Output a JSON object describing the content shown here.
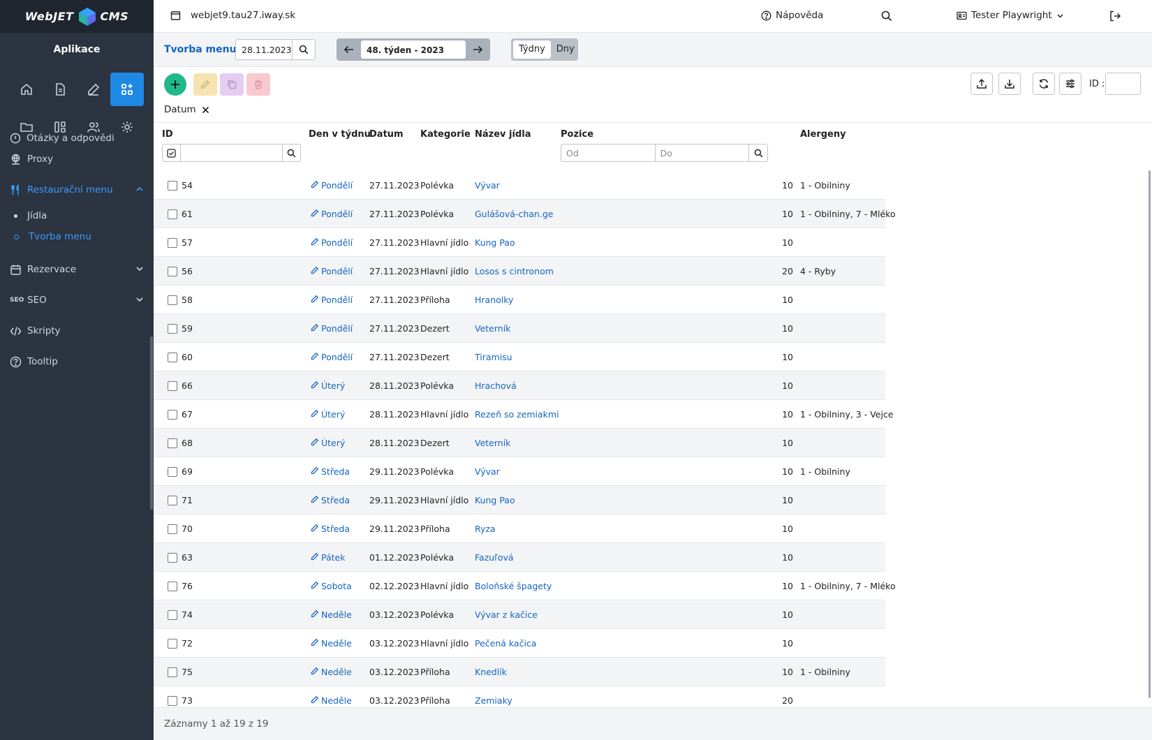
{
  "brand": {
    "left": "WebJET",
    "right": "CMS"
  },
  "sidebar": {
    "title": "Aplikace",
    "cut_item": "Otázky a odpovědi",
    "items": [
      {
        "label": "Proxy"
      },
      {
        "label": "Restaurační menu"
      },
      {
        "label": "Rezervace"
      },
      {
        "label": "SEO"
      },
      {
        "label": "Skripty"
      },
      {
        "label": "Tooltip"
      }
    ],
    "sub_items": [
      {
        "label": "Jídla"
      },
      {
        "label": "Tvorba menu"
      }
    ],
    "seo_badge": "SEO"
  },
  "topbar": {
    "host": "webjet9.tau27.iway.sk",
    "help": "Nápověda",
    "user": "Tester Playwright"
  },
  "filterbar": {
    "title": "Tvorba menu",
    "date": "28.11.2023",
    "week": "48. týden - 2023",
    "toggle_weeks": "Týdny",
    "toggle_days": "Dny"
  },
  "toolbar": {
    "id_label": "ID :",
    "filter_chip": "Datum"
  },
  "columns": {
    "id": "ID",
    "day": "Den v týdnu",
    "date": "Datum",
    "category": "Kategorie",
    "name": "Název jídla",
    "position": "Pozice",
    "allergens": "Alergeny",
    "pos_from": "Od",
    "pos_to": "Do"
  },
  "rows": [
    {
      "id": "54",
      "day": "Pondělí",
      "date": "27.11.2023",
      "category": "Polévka",
      "name": "Vývar",
      "position": "10",
      "allergens": "1 - Obilniny"
    },
    {
      "id": "61",
      "day": "Pondělí",
      "date": "27.11.2023",
      "category": "Polévka",
      "name": "Gulášová-chan.ge",
      "position": "10",
      "allergens": "1 - Obilniny, 7 - Mléko"
    },
    {
      "id": "57",
      "day": "Pondělí",
      "date": "27.11.2023",
      "category": "Hlavní jídlo",
      "name": "Kung Pao",
      "position": "10",
      "allergens": ""
    },
    {
      "id": "56",
      "day": "Pondělí",
      "date": "27.11.2023",
      "category": "Hlavní jídlo",
      "name": "Losos s cintronom",
      "position": "20",
      "allergens": "4 - Ryby"
    },
    {
      "id": "58",
      "day": "Pondělí",
      "date": "27.11.2023",
      "category": "Příloha",
      "name": "Hranolky",
      "position": "10",
      "allergens": ""
    },
    {
      "id": "59",
      "day": "Pondělí",
      "date": "27.11.2023",
      "category": "Dezert",
      "name": "Veterník",
      "position": "10",
      "allergens": ""
    },
    {
      "id": "60",
      "day": "Pondělí",
      "date": "27.11.2023",
      "category": "Dezert",
      "name": "Tiramisu",
      "position": "10",
      "allergens": ""
    },
    {
      "id": "66",
      "day": "Úterý",
      "date": "28.11.2023",
      "category": "Polévka",
      "name": "Hrachová",
      "position": "10",
      "allergens": ""
    },
    {
      "id": "67",
      "day": "Úterý",
      "date": "28.11.2023",
      "category": "Hlavní jídlo",
      "name": "Rezeň so zemiakmi",
      "position": "10",
      "allergens": "1 - Obilniny, 3 - Vejce"
    },
    {
      "id": "68",
      "day": "Úterý",
      "date": "28.11.2023",
      "category": "Dezert",
      "name": "Veterník",
      "position": "10",
      "allergens": ""
    },
    {
      "id": "69",
      "day": "Středa",
      "date": "29.11.2023",
      "category": "Polévka",
      "name": "Vývar",
      "position": "10",
      "allergens": "1 - Obilniny"
    },
    {
      "id": "71",
      "day": "Středa",
      "date": "29.11.2023",
      "category": "Hlavní jídlo",
      "name": "Kung Pao",
      "position": "10",
      "allergens": ""
    },
    {
      "id": "70",
      "day": "Středa",
      "date": "29.11.2023",
      "category": "Příloha",
      "name": "Ryza",
      "position": "10",
      "allergens": ""
    },
    {
      "id": "63",
      "day": "Pátek",
      "date": "01.12.2023",
      "category": "Polévka",
      "name": "Fazuľová",
      "position": "10",
      "allergens": ""
    },
    {
      "id": "76",
      "day": "Sobota",
      "date": "02.12.2023",
      "category": "Hlavní jídlo",
      "name": "Boloňské špagety",
      "position": "10",
      "allergens": "1 - Obilniny, 7 - Mléko"
    },
    {
      "id": "74",
      "day": "Neděle",
      "date": "03.12.2023",
      "category": "Polévka",
      "name": "Vývar z kačice",
      "position": "10",
      "allergens": ""
    },
    {
      "id": "72",
      "day": "Neděle",
      "date": "03.12.2023",
      "category": "Hlavní jídlo",
      "name": "Pečená kačica",
      "position": "10",
      "allergens": ""
    },
    {
      "id": "75",
      "day": "Neděle",
      "date": "03.12.2023",
      "category": "Příloha",
      "name": "Knedlík",
      "position": "10",
      "allergens": "1 - Obilniny"
    },
    {
      "id": "73",
      "day": "Neděle",
      "date": "03.12.2023",
      "category": "Příloha",
      "name": "Zemiaky",
      "position": "20",
      "allergens": ""
    }
  ],
  "footer": {
    "summary": "Záznamy 1 až 19 z 19"
  },
  "colors": {
    "sidebar": "#2b3440",
    "accent": "#1e88e5",
    "link": "#1565c0",
    "add": "#1fb98b",
    "edit": "#f6e3b0",
    "dup": "#e4ccf3",
    "del": "#f8c9cf"
  }
}
